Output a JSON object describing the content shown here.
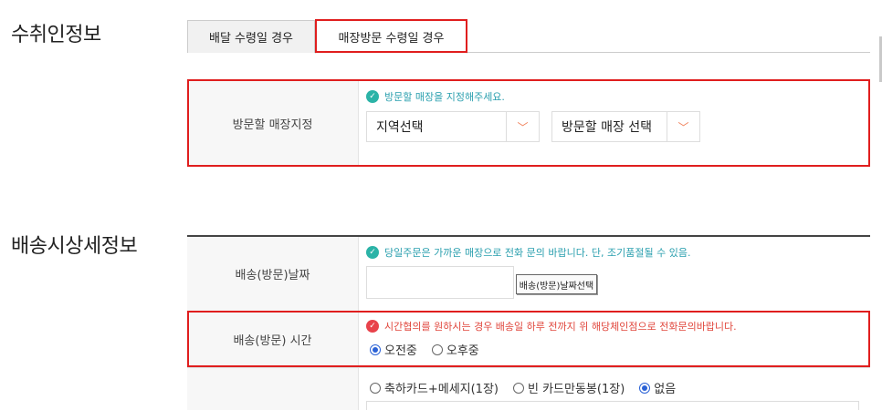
{
  "sections": {
    "receiver_info": "수취인정보",
    "delivery_detail": "배송시상세정보"
  },
  "tabs": [
    {
      "label": "배달 수령일 경우",
      "active": false
    },
    {
      "label": "매장방문 수령일 경우",
      "active": true
    }
  ],
  "store": {
    "label": "방문할 매장지정",
    "notice": "방문할 매장을 지정해주세요.",
    "region_select": "지역선택",
    "store_select": "방문할 매장 선택"
  },
  "date_row": {
    "label": "배송(방문)날짜",
    "notice": "당일주문은 가까운 매장으로 전화 문의 바랍니다. 단, 조기품절될 수 있음.",
    "input_value": "",
    "button_label": "배송(방문)날짜선택"
  },
  "time_row": {
    "label": "배송(방문) 시간",
    "notice": "시간협의를 원하시는 경우 배송일 하루 전까지 위 해당체인점으로 전화문의바랍니다.",
    "options": [
      {
        "label": "오전중",
        "selected": true
      },
      {
        "label": "오후중",
        "selected": false
      }
    ]
  },
  "card_row": {
    "label": "",
    "options": [
      {
        "label": "축하카드+메세지(1장)",
        "selected": false
      },
      {
        "label": "빈 카드만동봉(1장)",
        "selected": false
      },
      {
        "label": "없음",
        "selected": true
      }
    ]
  },
  "colors": {
    "highlight_red": "#e01e1e",
    "notice_teal": "#2a9fae",
    "notice_red": "#e0463c",
    "arrow_orange": "#f07c54",
    "radio_blue": "#2b62d6"
  }
}
